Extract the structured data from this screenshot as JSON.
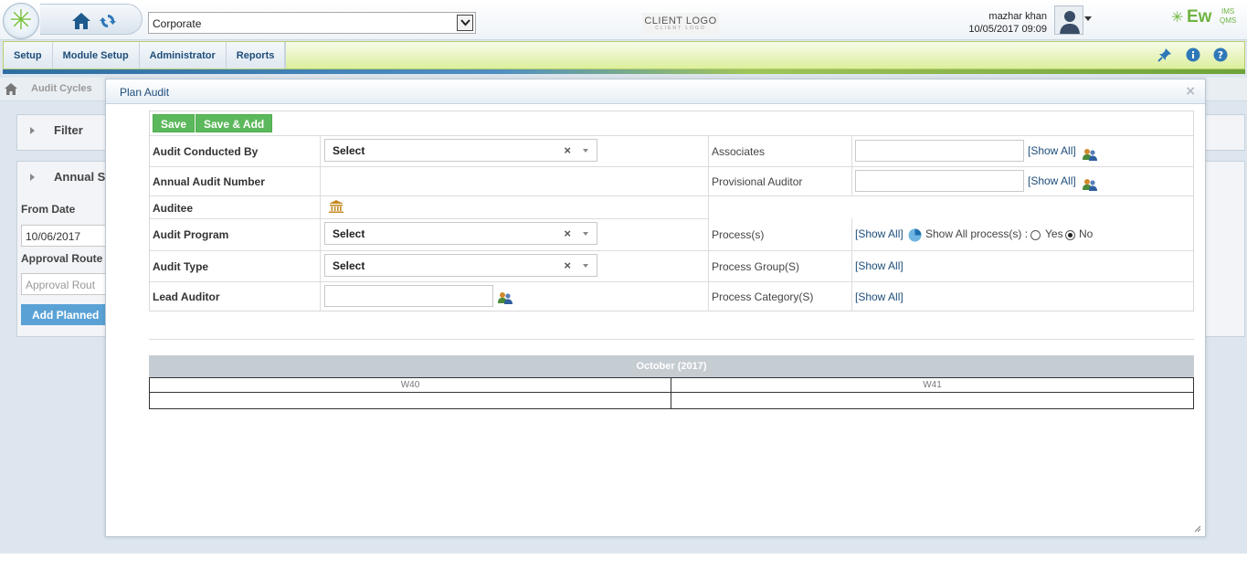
{
  "header": {
    "organization": "Corporate",
    "client_logo": "CLIENT LOGO",
    "client_logo_sub": "CLIENT LOGO",
    "user_name": "mazhar khan",
    "datetime": "10/05/2017 09:09",
    "brand_main": "Ew",
    "brand_top": "IMS",
    "brand_bottom": "QMS"
  },
  "nav": {
    "items": [
      {
        "label": "Setup"
      },
      {
        "label": "Module Setup"
      },
      {
        "label": "Administrator"
      },
      {
        "label": "Reports"
      }
    ]
  },
  "background_page": {
    "breadcrumb": "Audit Cycles",
    "filter_title": "Filter",
    "annual_title": "Annual Sc",
    "from_date_label": "From Date",
    "from_date_value": "10/06/2017",
    "approval_route_label": "Approval Route",
    "approval_route_placeholder": "Approval Rout",
    "add_button": "Add Planned"
  },
  "modal": {
    "title": "Plan Audit",
    "close": "×",
    "save": "Save",
    "save_add": "Save & Add",
    "fields": {
      "audit_conducted_by": {
        "label": "Audit Conducted By",
        "value": "Select"
      },
      "annual_audit_number": {
        "label": "Annual Audit Number"
      },
      "auditee": {
        "label": "Auditee"
      },
      "audit_program": {
        "label": "Audit Program",
        "value": "Select"
      },
      "audit_type": {
        "label": "Audit Type",
        "value": "Select"
      },
      "lead_auditor": {
        "label": "Lead Auditor",
        "value": ""
      },
      "associates": {
        "label": "Associates",
        "value": "",
        "link": "[Show All]"
      },
      "provisional_auditor": {
        "label": "Provisional Auditor",
        "value": "",
        "link": "[Show All]"
      },
      "processes": {
        "label": "Process(s)",
        "link": "[Show All]",
        "show_all_text": "Show All process(s) :",
        "yes": "Yes",
        "no": "No",
        "selected": "No"
      },
      "process_group": {
        "label": "Process Group(S)",
        "link": "[Show All]"
      },
      "process_category": {
        "label": "Process Category(S)",
        "link": "[Show All]"
      }
    },
    "calendar": {
      "month": "October (2017)",
      "weeks": [
        "W40",
        "W41"
      ]
    }
  },
  "colors": {
    "accent_blue": "#1e4d7a",
    "save_green": "#5cb85c",
    "nav_green": "#dcef9c",
    "brand_green": "#6fb43f"
  },
  "icons": {
    "home": "home-icon",
    "refresh": "refresh-icon",
    "pin": "pin-icon",
    "info": "info-icon",
    "help": "help-icon",
    "auditee": "building-icon",
    "people": "people-icon"
  }
}
